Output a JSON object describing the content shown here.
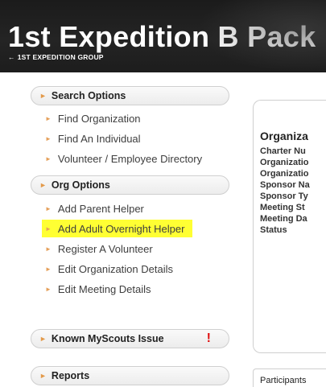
{
  "header": {
    "title": "1st Expedition B Pack",
    "back_arrow": "←",
    "back_link": "1ST EXPEDITION GROUP"
  },
  "sidebar": {
    "caret_glyph": "►",
    "bullet_glyph": "►",
    "search_options": {
      "label": "Search Options",
      "items": [
        "Find Organization",
        "Find An Individual",
        "Volunteer / Employee Directory"
      ]
    },
    "org_options": {
      "label": "Org Options",
      "items": [
        "Add Parent Helper",
        "Add Adult Overnight Helper",
        "Register A Volunteer",
        "Edit Organization Details",
        "Edit Meeting Details"
      ]
    },
    "known_issue": {
      "label": "Known MyScouts Issue",
      "alert": "!"
    },
    "reports": {
      "label": "Reports"
    }
  },
  "panel": {
    "title": "Organiza",
    "fields": [
      "Charter Nu",
      "Organizatio",
      "Organizatio",
      "Sponsor Na",
      "Sponsor Ty",
      "Meeting St",
      "Meeting Da",
      "Status"
    ]
  },
  "tabs": {
    "participants": "Participants"
  },
  "colors": {
    "header_bg": "#1b1b1b",
    "highlight": "#ffff33",
    "caret": "#e39a4a",
    "alert": "#e01010"
  }
}
